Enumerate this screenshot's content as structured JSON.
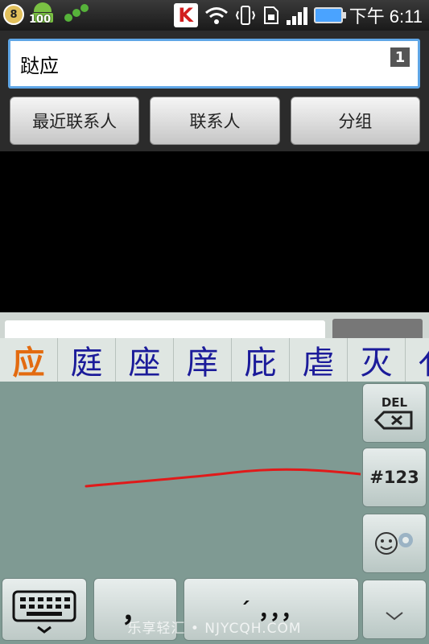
{
  "status_bar": {
    "badge_count": "8",
    "android_count": "100",
    "brand_letter": "K",
    "time": "下午 6:11"
  },
  "search": {
    "value": "跶应",
    "result_count": "1"
  },
  "tabs": [
    {
      "label": "最近联系人"
    },
    {
      "label": "联系人"
    },
    {
      "label": "分组"
    }
  ],
  "ime": {
    "candidates": [
      "应",
      "庭",
      "座",
      "庠",
      "庇",
      "虐",
      "灭",
      "亻"
    ],
    "selected_candidate_index": 0,
    "del_label": "DEL",
    "symbols_label": "#123",
    "emoji_glyph": "☺",
    "comma_key": "，",
    "punct_key": "ˊ ，，，",
    "stroke_color": "#e01a1a"
  },
  "watermark": "乐享轻汇 • NJYCQH.COM",
  "colors": {
    "accent_focus": "#5fa6e6",
    "keyboard_bg": "#7f9a93",
    "candidate_selected": "#e36b10",
    "candidate_default": "#1b1b9a"
  }
}
